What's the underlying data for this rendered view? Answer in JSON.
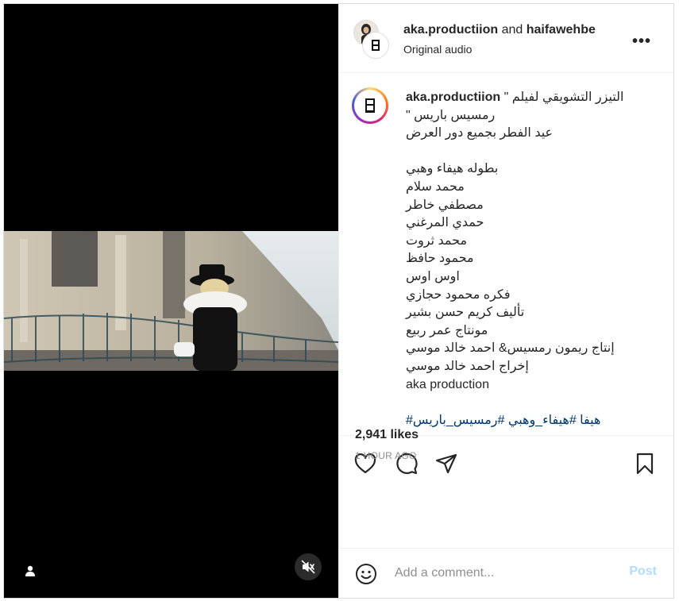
{
  "post": {
    "header": {
      "author": "aka.productiion",
      "connector": "and",
      "collaborator": "haifawehbe",
      "subtitle": "Original audio",
      "more_icon": "more-horizontal-icon"
    },
    "caption": {
      "username": "aka.productiion",
      "lines": [
        "\" التيزر التشويقي لفيلم",
        "\" رمسيس باريس",
        "عيد الفطر بجميع دور العرض",
        "",
        "بطوله هيفاء وهبي",
        "محمد سلام",
        "مصطفي خاطر",
        "حمدي المرغني",
        "محمد ثروت",
        "محمود حافظ",
        "اوس اوس",
        "فكره محمود حجازي",
        "تأليف كريم حسن بشير",
        "مونتاج عمر ربيع",
        "إنتاج ريمون رمسيس& احمد خالد موسي",
        "إخراج احمد خالد موسي",
        "aka production",
        ""
      ],
      "hashtags": "#هيفا #هيفاء_وهبي #رمسيس_باريس"
    },
    "actions": {
      "like_icon": "heart-icon",
      "comment_icon": "comment-icon",
      "share_icon": "send-icon",
      "save_icon": "bookmark-icon"
    },
    "likes": "2,941 likes",
    "time_ago": "1 HOUR AGO",
    "comment": {
      "placeholder": "Add a comment...",
      "post_label": "Post",
      "emoji_icon": "emoji-icon"
    },
    "media": {
      "user_tag_icon": "person-icon",
      "mute_icon": "muted-speaker-icon"
    }
  },
  "colors": {
    "link": "#00376b",
    "post_disabled": "#b3dbff",
    "muted_text": "#8e8e8e",
    "border": "#dbdbdb"
  }
}
